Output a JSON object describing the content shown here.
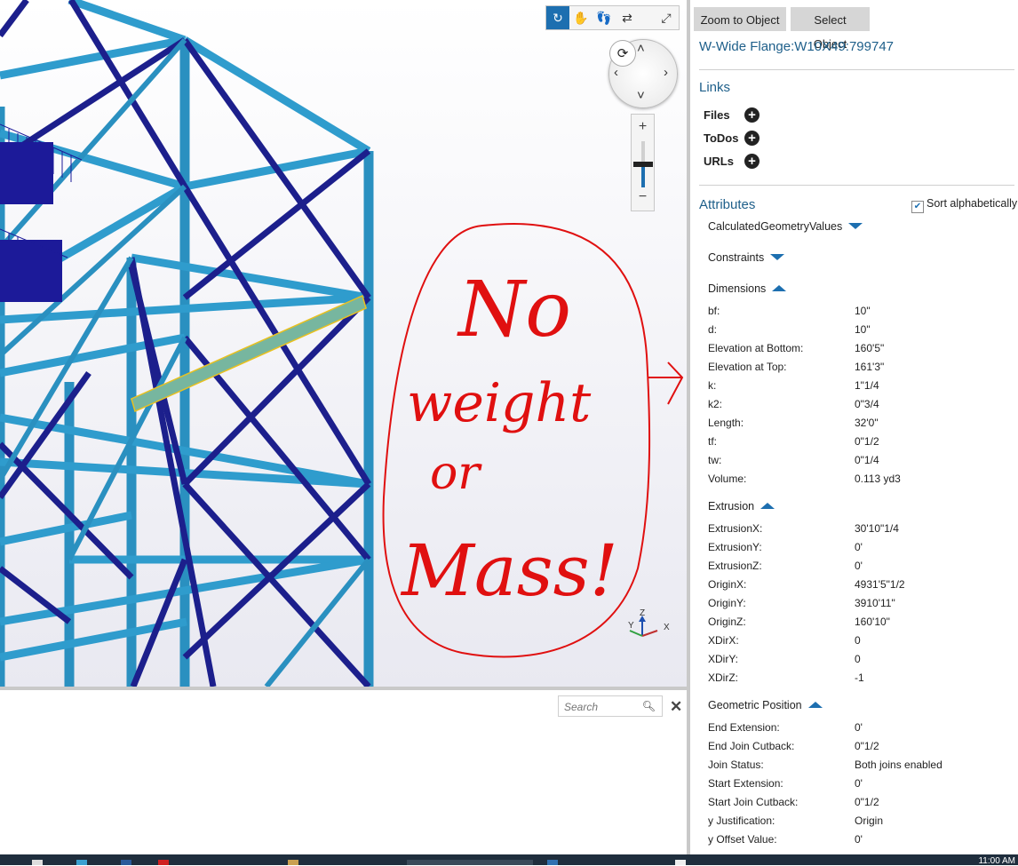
{
  "toolbar": {
    "tools": [
      "orbit-icon",
      "pan-icon",
      "walk-icon",
      "swap-icon",
      "fullscreen-icon"
    ],
    "active": "orbit-icon"
  },
  "zoom": {
    "plus": "+",
    "minus": "−",
    "level": 0.45
  },
  "axis": {
    "z": "Z",
    "y": "Y",
    "x": "X"
  },
  "annotation": {
    "color": "#e01010",
    "lines": [
      "No",
      "weight",
      "or",
      "Mass!"
    ]
  },
  "bottom_panel": {
    "search_placeholder": "Search"
  },
  "sidebar": {
    "zoom_to_object": "Zoom to Object",
    "select_object": "Select Object",
    "object_title": "W-Wide Flange:W10X49:799747",
    "links_heading": "Links",
    "links": [
      {
        "label": "Files"
      },
      {
        "label": "ToDos"
      },
      {
        "label": "URLs"
      }
    ],
    "attributes_heading": "Attributes",
    "sort_label": "Sort alphabetically",
    "sort_checked": true,
    "groups": {
      "calc": "CalculatedGeometryValues",
      "constraints": "Constraints",
      "dimensions": "Dimensions",
      "extrusion": "Extrusion",
      "geometric": "Geometric Position"
    },
    "dimensions": [
      {
        "k": "bf:",
        "v": "10\""
      },
      {
        "k": "d:",
        "v": "10\""
      },
      {
        "k": "Elevation at Bottom:",
        "v": "160'5\""
      },
      {
        "k": "Elevation at Top:",
        "v": "161'3\""
      },
      {
        "k": "k:",
        "v": "1\"1/4"
      },
      {
        "k": "k2:",
        "v": "0\"3/4"
      },
      {
        "k": "Length:",
        "v": "32'0\""
      },
      {
        "k": "tf:",
        "v": "0\"1/2"
      },
      {
        "k": "tw:",
        "v": "0\"1/4"
      },
      {
        "k": "Volume:",
        "v": "0.113 yd3"
      }
    ],
    "extrusion": [
      {
        "k": "ExtrusionX:",
        "v": "30'10\"1/4"
      },
      {
        "k": "ExtrusionY:",
        "v": "0'"
      },
      {
        "k": "ExtrusionZ:",
        "v": "0'"
      },
      {
        "k": "OriginX:",
        "v": "4931'5\"1/2"
      },
      {
        "k": "OriginY:",
        "v": "3910'11\""
      },
      {
        "k": "OriginZ:",
        "v": "160'10\""
      },
      {
        "k": "XDirX:",
        "v": "0"
      },
      {
        "k": "XDirY:",
        "v": "0"
      },
      {
        "k": "XDirZ:",
        "v": "-1"
      }
    ],
    "geometric": [
      {
        "k": "End Extension:",
        "v": "0'"
      },
      {
        "k": "End Join Cutback:",
        "v": "0\"1/2"
      },
      {
        "k": "Join Status:",
        "v": "Both joins enabled"
      },
      {
        "k": "Start Extension:",
        "v": "0'"
      },
      {
        "k": "Start Join Cutback:",
        "v": "0\"1/2"
      },
      {
        "k": "y Justification:",
        "v": "Origin"
      },
      {
        "k": "y Offset Value:",
        "v": "0'"
      }
    ]
  },
  "taskbar": {
    "clock": "11:00 AM"
  }
}
